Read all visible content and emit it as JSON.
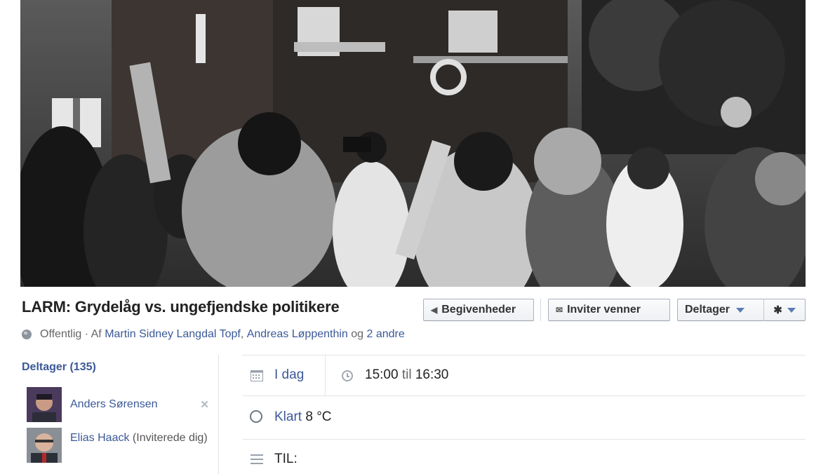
{
  "cover": {
    "alt_hint_colors": [
      "#1f1f1f",
      "#8a8a8a",
      "#d9d9d9"
    ]
  },
  "event": {
    "title": "LARM: Grydelåg vs. ungefjendske politikere",
    "privacy": "Offentlig",
    "by_prefix": " · Af ",
    "host1": "Martin Sidney Langdal Topf",
    "comma": ", ",
    "host2": "Andreas Løppenthin",
    "and": " og ",
    "others": "2 andre"
  },
  "toolbar": {
    "events_label": "Begivenheder",
    "invite_label": "Inviter venner",
    "attend_label": "Deltager"
  },
  "sidebar": {
    "heading": "Deltager (135)",
    "people": [
      {
        "name": "Anders Sørensen",
        "note": ""
      },
      {
        "name": "Elias Haack",
        "note": " (Inviterede dig)"
      }
    ]
  },
  "details": {
    "date": "I dag",
    "time_start": "15:00",
    "time_til": " til ",
    "time_end": "16:30",
    "weather_cond": "Klart",
    "weather_temp": " 8 °C",
    "to_label": "TIL:"
  }
}
